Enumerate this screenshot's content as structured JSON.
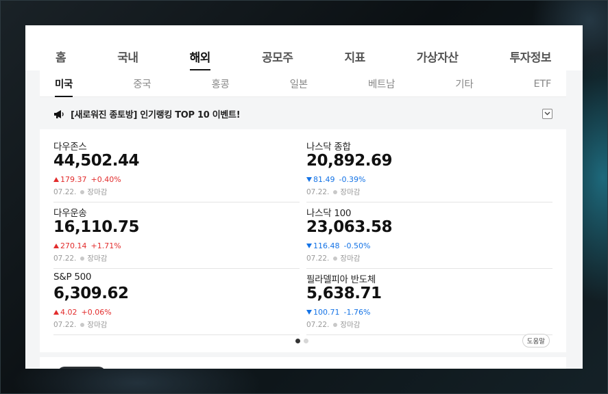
{
  "main_tabs": [
    {
      "label": "홈",
      "active": false
    },
    {
      "label": "국내",
      "active": false
    },
    {
      "label": "해외",
      "active": true
    },
    {
      "label": "공모주",
      "active": false
    },
    {
      "label": "지표",
      "active": false
    },
    {
      "label": "가상자산",
      "active": false
    },
    {
      "label": "투자정보",
      "active": false
    }
  ],
  "sub_tabs": [
    {
      "label": "미국",
      "active": true
    },
    {
      "label": "중국",
      "active": false
    },
    {
      "label": "홍콩",
      "active": false
    },
    {
      "label": "일본",
      "active": false
    },
    {
      "label": "베트남",
      "active": false
    },
    {
      "label": "기타",
      "active": false
    },
    {
      "label": "ETF",
      "active": false
    }
  ],
  "notice": {
    "icon": "megaphone-icon",
    "text": "[새로워진 종토방] 인기랭킹 TOP 10 이벤트!",
    "toggle_icon": "chevron-down-icon"
  },
  "indices": [
    {
      "name": "다우존스",
      "value": "44,502.44",
      "direction": "up",
      "change": "179.37",
      "pct": "+0.40%",
      "date": "07.22.",
      "status": "장마감"
    },
    {
      "name": "나스닥 종합",
      "value": "20,892.69",
      "direction": "down",
      "change": "81.49",
      "pct": "-0.39%",
      "date": "07.22.",
      "status": "장마감"
    },
    {
      "name": "다우운송",
      "value": "16,110.75",
      "direction": "up",
      "change": "270.14",
      "pct": "+1.71%",
      "date": "07.22.",
      "status": "장마감"
    },
    {
      "name": "나스닥 100",
      "value": "23,063.58",
      "direction": "down",
      "change": "116.48",
      "pct": "-0.50%",
      "date": "07.22.",
      "status": "장마감"
    },
    {
      "name": "S&P 500",
      "value": "6,309.62",
      "direction": "up",
      "change": "4.02",
      "pct": "+0.06%",
      "date": "07.22.",
      "status": "장마감"
    },
    {
      "name": "필라델피아 반도체",
      "value": "5,638.71",
      "direction": "down",
      "change": "100.71",
      "pct": "-1.76%",
      "date": "07.22.",
      "status": "장마감"
    }
  ],
  "pager": {
    "pages": 2,
    "current": 1
  },
  "help_label": "도움말",
  "colors": {
    "up": "#e22c2c",
    "down": "#1473e6"
  }
}
